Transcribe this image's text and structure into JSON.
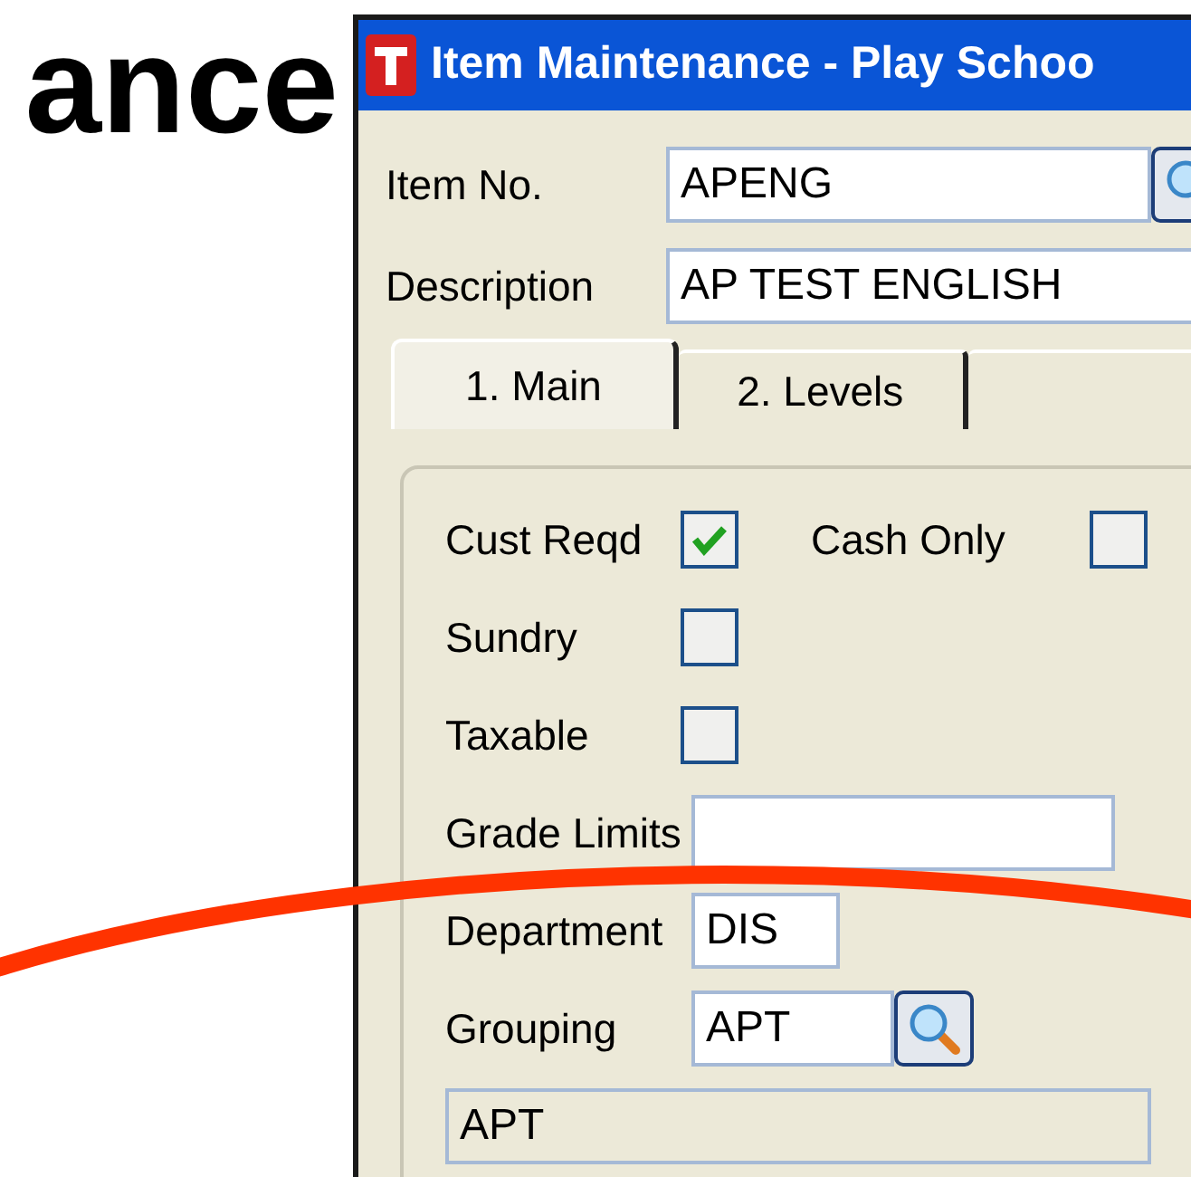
{
  "slide_title": "ance",
  "window": {
    "title": "Item Maintenance - Play Schoo"
  },
  "header_fields": [
    {
      "label": "Item No.",
      "value": "APENG",
      "kind": "lookup"
    },
    {
      "label": "Description",
      "value": "AP TEST ENGLISH",
      "kind": "text"
    }
  ],
  "tabs": [
    {
      "label": "1. Main",
      "selected": true
    },
    {
      "label": "2. Levels",
      "selected": false
    },
    {
      "selected": false
    }
  ],
  "panel": {
    "rows": [
      [
        {
          "kind": "checkbox",
          "label": "Cust Reqd",
          "checked": true
        },
        {
          "kind": "checkbox",
          "label": "Cash Only",
          "checked": false
        }
      ],
      [
        {
          "kind": "checkbox",
          "label": "Sundry",
          "checked": false
        }
      ],
      [
        {
          "kind": "checkbox",
          "label": "Taxable",
          "checked": false
        }
      ],
      [
        {
          "kind": "text",
          "label": "Grade Limits"
        }
      ],
      [
        {
          "kind": "short",
          "label": "Department",
          "value": "DIS"
        }
      ],
      [
        {
          "kind": "lookup",
          "label": "Grouping",
          "value": "APT"
        }
      ]
    ],
    "summary": {
      "value": "APT",
      "disabled": true
    }
  }
}
